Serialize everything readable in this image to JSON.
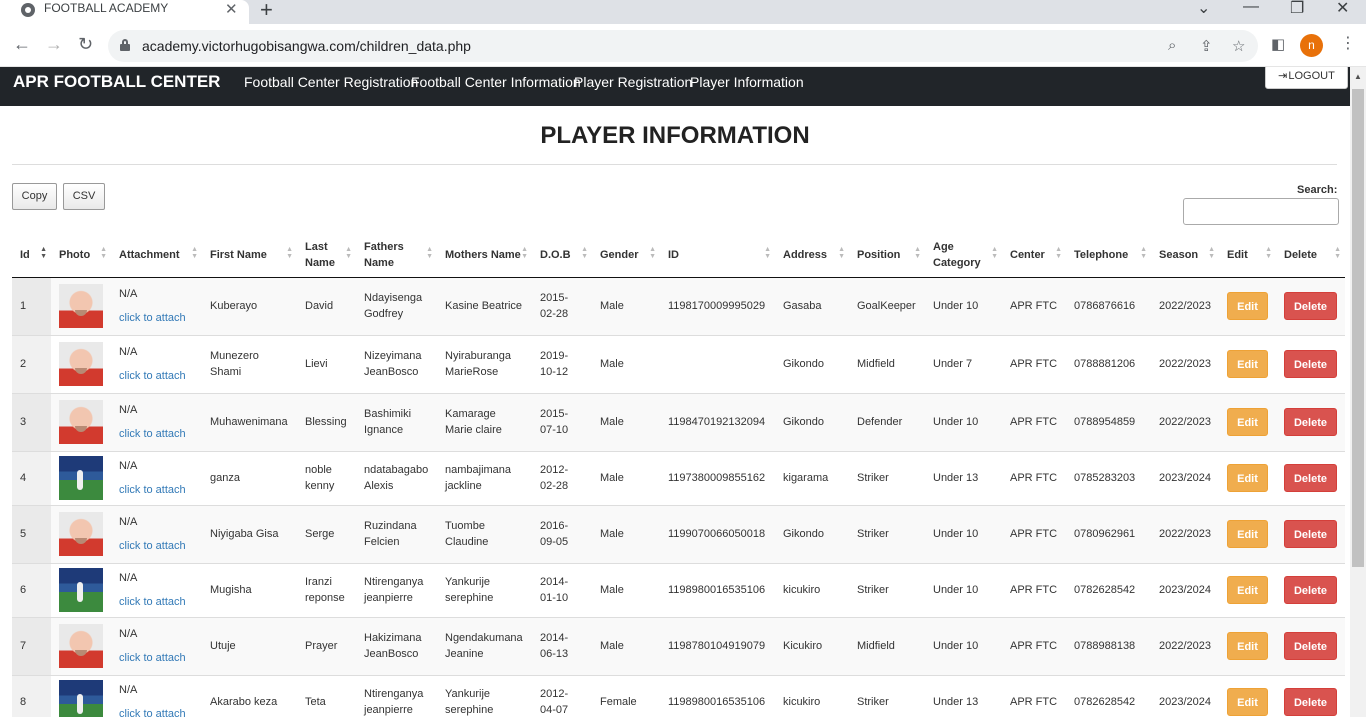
{
  "browser": {
    "tab_title": "FOOTBALL ACADEMY",
    "url": "academy.victorhugobisangwa.com/children_data.php",
    "profile_initial": "n"
  },
  "nav": {
    "brand": "APR FOOTBALL CENTER",
    "links": [
      "Football Center Registration",
      "Football Center Information",
      "Player Registration",
      "Player Information"
    ],
    "logout": "LOGOUT"
  },
  "page": {
    "title": "PLAYER INFORMATION",
    "copy_label": "Copy",
    "csv_label": "CSV",
    "search_label": "Search:",
    "search_value": ""
  },
  "table": {
    "columns": [
      "Id",
      "Photo",
      "Attachment",
      "First Name",
      "Last Name",
      "Fathers Name",
      "Mothers Name",
      "D.O.B",
      "Gender",
      "ID",
      "Address",
      "Position",
      "Age Category",
      "Center",
      "Telephone",
      "Season",
      "Edit",
      "Delete"
    ],
    "na_text": "N/A",
    "attach_text": "click to attach",
    "edit_label": "Edit",
    "delete_label": "Delete",
    "rows": [
      {
        "id": "1",
        "photo": "coach",
        "first": "Kuberayo",
        "last": "David",
        "father": "Ndayisenga Godfrey",
        "mother": "Kasine Beatrice",
        "dob": "2015-02-28",
        "gender": "Male",
        "nid": "1198170009995029",
        "address": "Gasaba",
        "position": "GoalKeeper",
        "age": "Under 10",
        "center": "APR FTC",
        "phone": "0786876616",
        "season": "2022/2023"
      },
      {
        "id": "2",
        "photo": "coach",
        "first": "Munezero Shami",
        "last": "Lievi",
        "father": "Nizeyimana JeanBosco",
        "mother": "Nyiraburanga MarieRose",
        "dob": "2019-10-12",
        "gender": "Male",
        "nid": "",
        "address": "Gikondo",
        "position": "Midfield",
        "age": "Under 7",
        "center": "APR FTC",
        "phone": "0788881206",
        "season": "2022/2023"
      },
      {
        "id": "3",
        "photo": "coach",
        "first": "Muhawenimana",
        "last": "Blessing",
        "father": "Bashimiki Ignance",
        "mother": "Kamarage Marie claire",
        "dob": "2015-07-10",
        "gender": "Male",
        "nid": "1198470192132094",
        "address": "Gikondo",
        "position": "Defender",
        "age": "Under 10",
        "center": "APR FTC",
        "phone": "0788954859",
        "season": "2022/2023"
      },
      {
        "id": "4",
        "photo": "field",
        "first": "ganza",
        "last": "noble kenny",
        "father": "ndatabagabo Alexis",
        "mother": "nambajimana jackline",
        "dob": "2012-02-28",
        "gender": "Male",
        "nid": "1197380009855162",
        "address": "kigarama",
        "position": "Striker",
        "age": "Under 13",
        "center": "APR FTC",
        "phone": "0785283203",
        "season": "2023/2024"
      },
      {
        "id": "5",
        "photo": "coach",
        "first": "Niyigaba Gisa",
        "last": "Serge",
        "father": "Ruzindana Felcien",
        "mother": "Tuombe Claudine",
        "dob": "2016-09-05",
        "gender": "Male",
        "nid": "1199070066050018",
        "address": "Gikondo",
        "position": "Striker",
        "age": "Under 10",
        "center": "APR FTC",
        "phone": "0780962961",
        "season": "2022/2023"
      },
      {
        "id": "6",
        "photo": "field",
        "first": "Mugisha",
        "last": "Iranzi reponse",
        "father": "Ntirenganya jeanpierre",
        "mother": "Yankurije serephine",
        "dob": "2014-01-10",
        "gender": "Male",
        "nid": "1198980016535106",
        "address": "kicukiro",
        "position": "Striker",
        "age": "Under 10",
        "center": "APR FTC",
        "phone": "0782628542",
        "season": "2023/2024"
      },
      {
        "id": "7",
        "photo": "coach",
        "first": "Utuje",
        "last": "Prayer",
        "father": "Hakizimana JeanBosco",
        "mother": "Ngendakumana Jeanine",
        "dob": "2014-06-13",
        "gender": "Male",
        "nid": "1198780104919079",
        "address": "Kicukiro",
        "position": "Midfield",
        "age": "Under 10",
        "center": "APR FTC",
        "phone": "0788988138",
        "season": "2022/2023"
      },
      {
        "id": "8",
        "photo": "field",
        "first": "Akarabo keza",
        "last": "Teta",
        "father": "Ntirenganya jeanpierre",
        "mother": "Yankurije serephine",
        "dob": "2012-04-07",
        "gender": "Female",
        "nid": "1198980016535106",
        "address": "kicukiro",
        "position": "Striker",
        "age": "Under 13",
        "center": "APR FTC",
        "phone": "0782628542",
        "season": "2023/2024"
      }
    ]
  }
}
